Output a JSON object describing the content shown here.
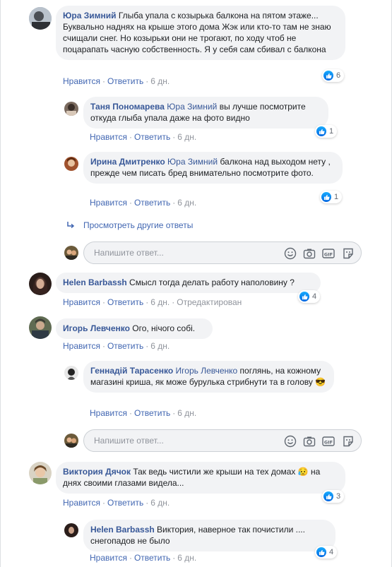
{
  "actions": {
    "like": "Нравится",
    "reply": "Ответить",
    "dot": "·",
    "time": "6 дн.",
    "edited": "Отредактирован"
  },
  "comments": [
    {
      "author": "Юра Зимний",
      "text": "Глыба упала с козырька балкона на пятом этаже... Буквально наднях на крыше этого дома Жэк или кто-то там не знаю счищали снег. Но козырьки они не трогают, по ходу чтоб не поцарапать часную собственность. Я у себя сам сбивал с балкона",
      "likes": "6"
    },
    {
      "author": "Таня Пономарева",
      "mention": "Юра Зимний",
      "text": "вы лучше посмотрите откуда глыба упала даже на фото видно",
      "likes": "1"
    },
    {
      "author": "Ирина Дмитренко",
      "mention": "Юра Зимний",
      "text": "балкона над выходом нету , прежде чем писать бред внимательно посмотрите фото.",
      "likes": "1"
    },
    {
      "author": "Helen Barbassh",
      "text": "Смысл тогда делать работу наполовину ?",
      "likes": "4"
    },
    {
      "author": "Игорь Левченко",
      "text": "Ого, нічого собі."
    },
    {
      "author": "Геннадій Тарасенко",
      "mention": "Игорь Левченко",
      "text": "поглянь, на кожному магазині криша, як може бурулька стрибнути та в голову 😎"
    },
    {
      "author": "Виктория Дячок",
      "text": "Так ведь чистили же крыши на тех домах 😥 на днях своими глазами видела...",
      "likes": "3"
    },
    {
      "author": "Helen Barbassh",
      "text": "Виктория, наверное так почистили .... снегопадов не было",
      "likes": "4"
    }
  ],
  "more_replies": "Просмотреть другие ответы",
  "reply_placeholder": "Напишите ответ...",
  "icons": [
    "smile-icon",
    "camera-icon",
    "gif-icon",
    "sticker-icon",
    "like-icon",
    "reply-arrow-icon"
  ],
  "colors": {
    "link": "#385898",
    "bubble": "#f2f3f5",
    "meta": "#90949c",
    "like": "#1877f2"
  }
}
